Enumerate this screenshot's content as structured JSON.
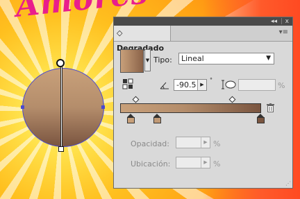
{
  "artwork": {
    "title_text": "Amores"
  },
  "panel": {
    "titlebar": {
      "collapse_label": "◂◂",
      "close_label": "x"
    },
    "tab_label": "Degradado",
    "tab_prefix": "◇",
    "menu_icon": "panel-menu-icon",
    "type_label": "Tipo:",
    "type_value": "Lineal",
    "angle_value": "-90.5",
    "angle_unit": "°",
    "aspect_value": "",
    "aspect_unit": "%",
    "opacity_label": "Opacidad:",
    "opacity_value": "",
    "opacity_unit": "%",
    "location_label": "Ubicación:",
    "location_value": "",
    "location_unit": "%",
    "gradient_stops": [
      {
        "color": "#c8a07a"
      },
      {
        "color": "#c19a76"
      },
      {
        "color": "#7a5540"
      }
    ],
    "colors": {
      "start": "#c8a07a",
      "end": "#7a5540",
      "panel_bg": "#d9d9d9",
      "titlebar": "#4a4a4a"
    }
  }
}
